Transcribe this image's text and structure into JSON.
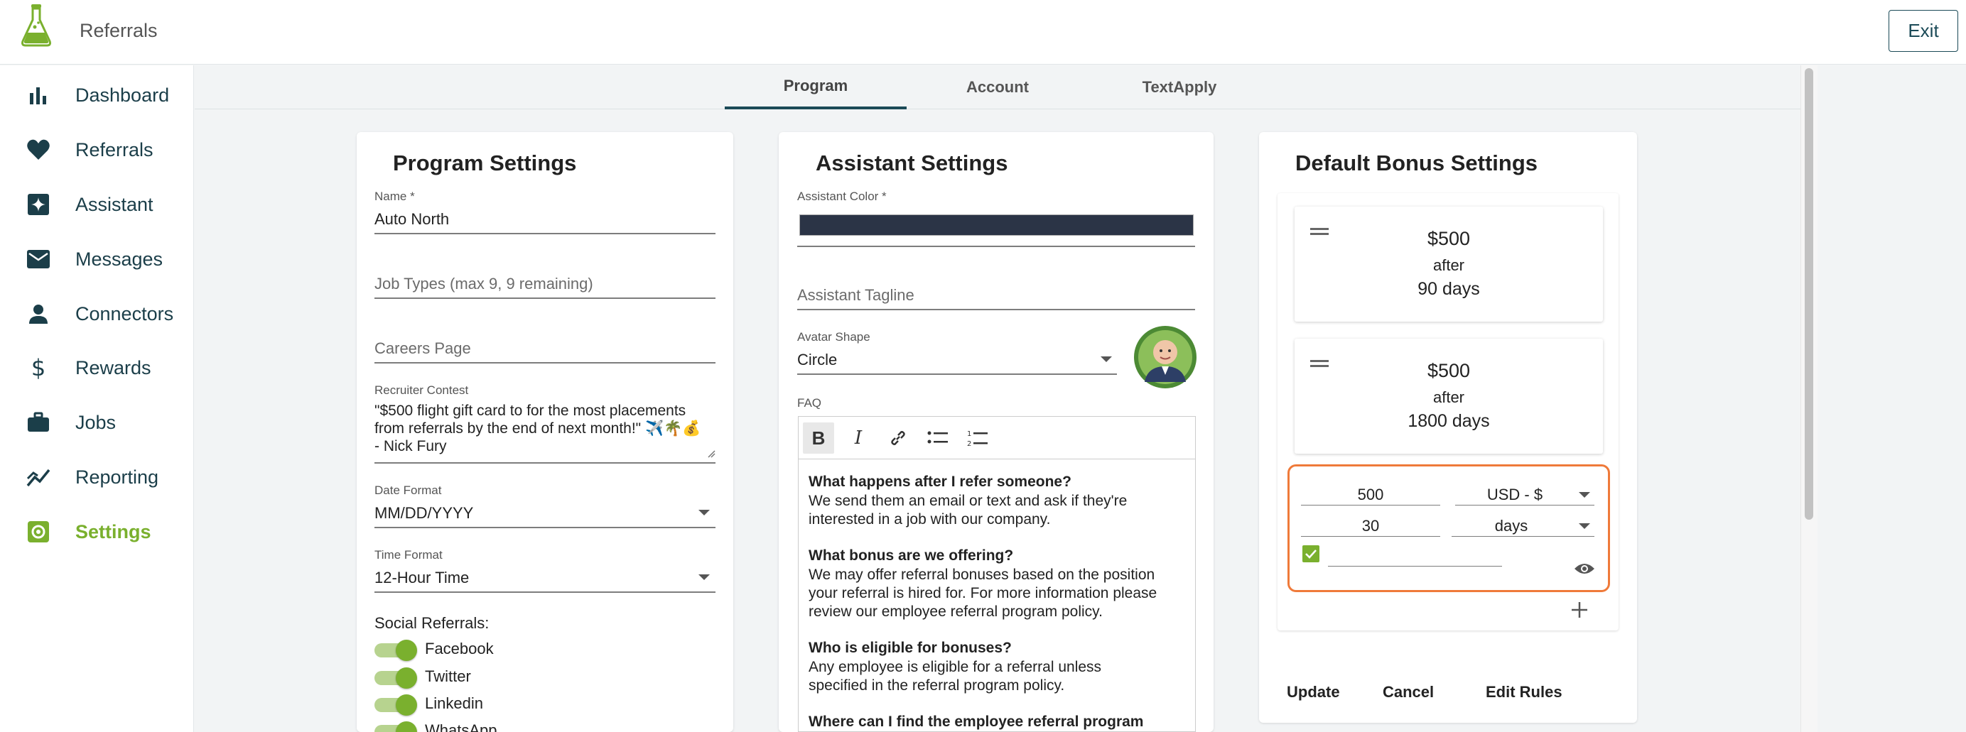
{
  "app": {
    "title": "Referrals",
    "exit_label": "Exit"
  },
  "colors": {
    "accent_green": "#7ab02e",
    "primary_navy": "#1b4a57",
    "assistant_color": "#2b3446",
    "highlight_orange": "#ef7a3a"
  },
  "sidebar": {
    "items": [
      {
        "label": "Dashboard",
        "icon": "bar-chart-icon"
      },
      {
        "label": "Referrals",
        "icon": "heart-icon"
      },
      {
        "label": "Assistant",
        "icon": "sparkle-icon"
      },
      {
        "label": "Messages",
        "icon": "envelope-icon"
      },
      {
        "label": "Connectors",
        "icon": "person-icon"
      },
      {
        "label": "Rewards",
        "icon": "dollar-icon"
      },
      {
        "label": "Jobs",
        "icon": "briefcase-icon"
      },
      {
        "label": "Reporting",
        "icon": "trend-icon"
      },
      {
        "label": "Settings",
        "icon": "settings-icon",
        "active": true
      }
    ]
  },
  "tabs": [
    {
      "label": "Program",
      "active": true
    },
    {
      "label": "Account"
    },
    {
      "label": "TextApply"
    }
  ],
  "program": {
    "title": "Program Settings",
    "name_label": "Name *",
    "name_value": "Auto North",
    "job_types_placeholder": "Job Types (max 9, 9 remaining)",
    "careers_placeholder": "Careers Page",
    "contest_label": "Recruiter Contest",
    "contest_line1": "\"$500 flight gift card to for the most placements",
    "contest_line2": "from referrals by the end of next month!\" ✈️🌴💰",
    "contest_line3": "- Nick Fury",
    "date_format_label": "Date Format",
    "date_format_value": "MM/DD/YYYY",
    "time_format_label": "Time Format",
    "time_format_value": "12-Hour Time",
    "social_label": "Social Referrals:",
    "social": [
      {
        "label": "Facebook",
        "on": true
      },
      {
        "label": "Twitter",
        "on": true
      },
      {
        "label": "Linkedin",
        "on": true
      },
      {
        "label": "WhatsApp",
        "on": true
      }
    ]
  },
  "assistant": {
    "title": "Assistant Settings",
    "color_label": "Assistant Color *",
    "tagline_placeholder": "Assistant Tagline",
    "avatar_shape_label": "Avatar Shape",
    "avatar_shape_value": "Circle",
    "faq_label": "FAQ",
    "faq": [
      {
        "q": "What happens after I refer someone?",
        "a1": "We send them an email or text and ask if they're",
        "a2": "interested in a job with our company.",
        "a3": ""
      },
      {
        "q": "What bonus are we offering?",
        "a1": "We may offer referral bonuses based on the position",
        "a2": "your referral is hired for. For more information please",
        "a3": "review our employee referral program policy."
      },
      {
        "q": "Who is eligible for bonuses?",
        "a1": "Any employee is eligible for a referral unless",
        "a2": "specified in the referral program policy.",
        "a3": ""
      },
      {
        "q": "Where can I find the employee referral program",
        "a1": "",
        "a2": "",
        "a3": ""
      }
    ]
  },
  "bonus": {
    "title": "Default Bonus Settings",
    "items": [
      {
        "amount": "$500",
        "after": "after",
        "days": "90 days"
      },
      {
        "amount": "$500",
        "after": "after",
        "days": "1800 days"
      }
    ],
    "edit": {
      "amount": "500",
      "currency": "USD - $",
      "duration": "30",
      "unit": "days",
      "checked": true
    },
    "update_label": "Update",
    "cancel_label": "Cancel",
    "edit_rules_label": "Edit Rules"
  }
}
